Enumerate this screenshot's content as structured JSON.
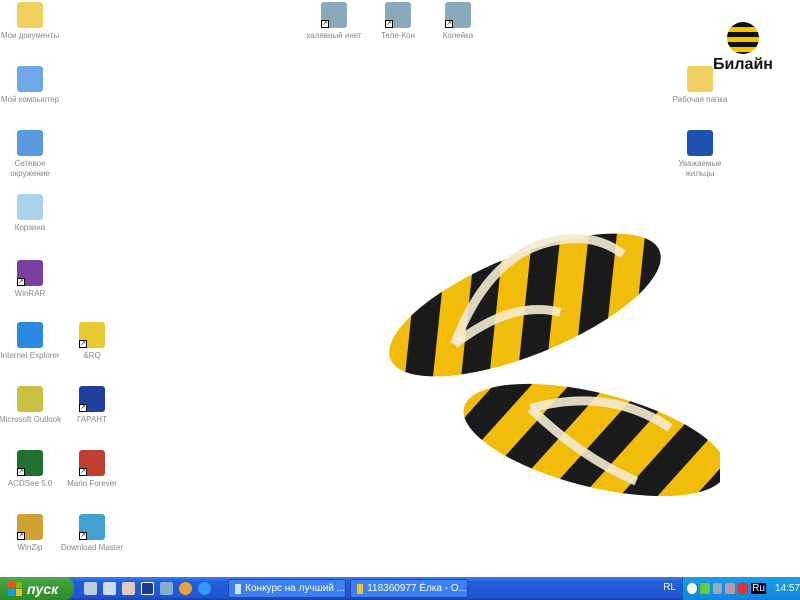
{
  "desktop": {
    "left_icons": [
      {
        "label": "Мои документы",
        "icon": "my-documents-icon",
        "color": "#f0d060"
      },
      {
        "label": "Мой компьютер",
        "icon": "my-computer-icon",
        "color": "#6fa8e8"
      },
      {
        "label": "Сетевое окружение",
        "icon": "network-icon",
        "color": "#5a9be0"
      },
      {
        "label": "Корзина",
        "icon": "recycle-bin-icon",
        "color": "#a8d4ee"
      },
      {
        "label": "WinRAR",
        "icon": "winrar-icon",
        "color": "#7a3fa0"
      },
      {
        "label": "Internet Explorer",
        "icon": "internet-explorer-icon",
        "color": "#2a8ae0"
      },
      {
        "label": "&RQ",
        "icon": "rq-icon",
        "color": "#e8c830"
      },
      {
        "label": "Microsoft Outlook",
        "icon": "outlook-icon",
        "color": "#c8c040"
      },
      {
        "label": "ГАРАНТ",
        "icon": "garant-icon",
        "color": "#2040a0"
      },
      {
        "label": "ACDSee 5.0",
        "icon": "acdsee-icon",
        "color": "#207030"
      },
      {
        "label": "Mario Forever",
        "icon": "mario-icon",
        "color": "#c04030"
      },
      {
        "label": "WinZip",
        "icon": "winzip-icon",
        "color": "#d0a030"
      },
      {
        "label": "Download Master",
        "icon": "download-master-icon",
        "color": "#40a0d0"
      }
    ],
    "top_icons": [
      {
        "label": "халявный инет",
        "icon": "network-connection-icon"
      },
      {
        "label": "Теле-Кон",
        "icon": "network-connection-icon"
      },
      {
        "label": "Копейка",
        "icon": "network-connection-icon"
      }
    ],
    "right_icons": [
      {
        "label": "Рабочая папка",
        "icon": "folder-icon",
        "color": "#f0d060"
      },
      {
        "label": "Уважаемые жильцы",
        "icon": "word-document-icon",
        "color": "#2050b0"
      }
    ],
    "logo": "Билайн"
  },
  "taskbar": {
    "start_label": "пуск",
    "tasks": [
      {
        "label": "Конкурс на лучший ..."
      },
      {
        "label": "118360977 Ёлка - О..."
      }
    ],
    "language": "RL",
    "tray_lang": "Ru",
    "clock": "14:57"
  },
  "colors": {
    "accent_yellow": "#f5c400",
    "taskbar": "#245edb"
  }
}
